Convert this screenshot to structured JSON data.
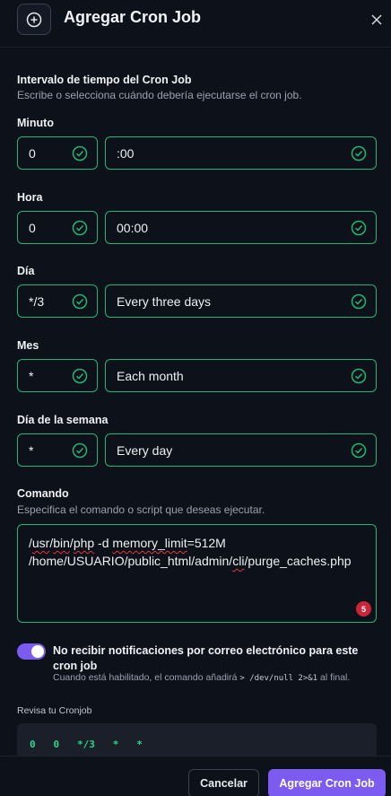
{
  "dialog": {
    "title": "Agregar Cron Job"
  },
  "interval": {
    "title": "Intervalo de tiempo del Cron Job",
    "description": "Escribe o selecciona cuándo debería ejecutarse el cron job."
  },
  "fields": {
    "minute": {
      "label": "Minuto",
      "value": "0",
      "description": ":00"
    },
    "hour": {
      "label": "Hora",
      "value": "0",
      "description": "00:00"
    },
    "day": {
      "label": "Día",
      "value": "*/3",
      "description": "Every three days"
    },
    "month": {
      "label": "Mes",
      "value": "*",
      "description": "Each month"
    },
    "weekday": {
      "label": "Día de la semana",
      "value": "*",
      "description": "Every day"
    }
  },
  "command": {
    "title": "Comando",
    "description": "Especifica el comando o script que deseas ejecutar.",
    "parts": {
      "slash1": "/",
      "usr": "usr",
      "slash2": "/",
      "bin": "bin",
      "slash3": "/",
      "php": "php",
      "mid": " -d ",
      "memlimit": "memory_limit",
      "eq": "=512M",
      "path1": "/home/USUARIO/public_html/admin/",
      "cli": "cli",
      "path2": "/purge_caches.php"
    },
    "error_count": "5"
  },
  "notifications": {
    "label": "No recibir notificaciones por correo electrónico para este cron job",
    "hint_prefix": "Cuando está habilitado, el comando añadirá",
    "hint_code": "> /dev/null 2>&1",
    "hint_suffix": "al final.",
    "enabled": true
  },
  "review": {
    "label": "Revisa tu Cronjob",
    "cron_line": "0   0   */3   *   *"
  },
  "footer": {
    "cancel_label": "Cancelar",
    "add_label": "Agregar Cron Job"
  },
  "colors": {
    "accent": "#7c5cf0",
    "valid": "#22b573",
    "error": "#c8243a",
    "background": "#0d111a"
  },
  "icons": {
    "header": "plus-circle-icon",
    "close": "close-icon",
    "valid": "check-circle-icon"
  }
}
